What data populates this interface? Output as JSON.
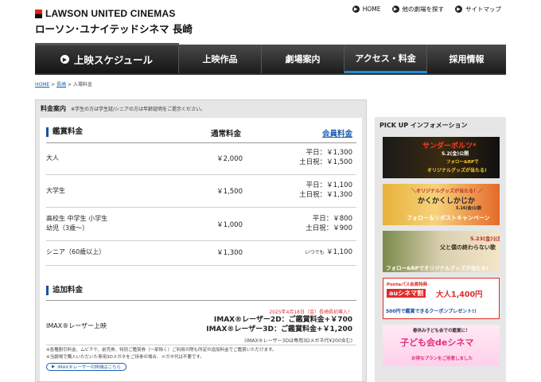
{
  "header": {
    "logo_en": "LAWSON UNITED CINEMAS",
    "logo_jp": "ローソン･ユナイテッドシネマ 長崎",
    "top_links": [
      {
        "label": "HOME",
        "icon": "home-icon"
      },
      {
        "label": "他の劇場を探す",
        "icon": "search-icon"
      },
      {
        "label": "サイトマップ",
        "icon": "sitemap-icon"
      }
    ]
  },
  "nav": {
    "schedule": "上映スケジュール",
    "items": [
      "上映作品",
      "劇場案内",
      "アクセス・料金",
      "採用情報"
    ],
    "active_index": 2,
    "accent": "#1e8cd8"
  },
  "breadcrumb": [
    "HOME",
    "長崎",
    "入場料金"
  ],
  "price_panel": {
    "title": "料金案内",
    "note": "※学生の方は学生証/シニアの方は年齢証明をご提示ください。",
    "section1": {
      "title": "鑑賞料金",
      "col_regular": "通常料金",
      "col_member": "会員料金",
      "rows": [
        {
          "label": "大人",
          "label2": "",
          "price": "￥2,000",
          "m1": "平日：￥1,300",
          "m2": "土日祝：￥1,500"
        },
        {
          "label": "大学生",
          "label2": "",
          "price": "￥1,500",
          "m1": "平日：￥1,100",
          "m2": "土日祝：￥1,300"
        },
        {
          "label": "高校生 中学生 小学生",
          "label2": "幼児（3歳〜）",
          "price": "￥1,000",
          "m1": "平日：￥800",
          "m2": "土日祝：￥900"
        },
        {
          "label": "シニア（60歳以上）",
          "label2": "",
          "price": "￥1,300",
          "m1_small": "いつでも",
          "m1": "￥1,100",
          "m2": ""
        }
      ]
    },
    "section2": {
      "title": "追加料金",
      "imax_label": "IMAX®レーザー上映",
      "imax_date": "2025年4月18日（金）長崎県初導入！",
      "imax_2d": "IMAX®レーザー2D：ご鑑賞料金+￥700",
      "imax_3d": "IMAX®レーザー3D：ご鑑賞料金+￥1,200",
      "imax_note": "(IMAX®レーザー3Dは専用3Dメガネ代¥200含む)",
      "fine1": "※各種割引料金、ムビチケ、前売券、特別ご鑑賞券（一部除く）ご利用の際も所定の追加料金でご鑑賞いただけます。",
      "fine2": "※当劇場で購入いただいた専用3Dメガネをご持参の場合、メガネ代は不要です。",
      "detail_button": "IMAX®レーザーの詳細はこちら"
    }
  },
  "pickup": {
    "title": "PICK UP インフォメーション",
    "banners": [
      {
        "title": "サンダーボルツ*",
        "sub": "5.2(金)公開",
        "extra": "フォロー&RPで",
        "extra2": "オリジナルグッズが当たる!"
      },
      {
        "title": "＼オリジナルグッズが当たる！／",
        "sub": "かくかくしかじか",
        "extra": "5.16(金)公開",
        "extra2": "フォロー＆リポストキャンペーン"
      },
      {
        "title": "5.23(金)公開",
        "sub": "父と僕の終わらない歌",
        "extra2": "フォロー&RPでオリジナルグッズが当たる!"
      },
      {
        "title": "Pontaパス会員特典",
        "sub": "auシネマ割",
        "extra": "大人1,400円",
        "extra2": "500円で鑑賞できるクーポンプレゼント!!"
      },
      {
        "title": "春休み子ども会での鑑賞に！",
        "sub": "子ども会deシネマ",
        "extra2": "お得なプランをご用意しました"
      }
    ]
  }
}
